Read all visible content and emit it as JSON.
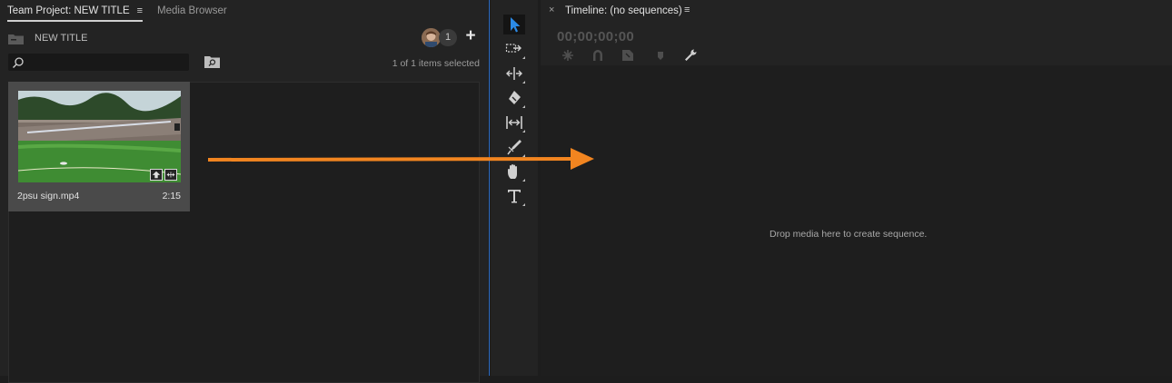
{
  "project_panel": {
    "tab_project": "Team Project: NEW TITLE",
    "tab_menu": "≡",
    "tab_media": "Media Browser",
    "project_name": "NEW TITLE",
    "collaborators_count": "1",
    "add_label": "+",
    "search": {
      "value": "",
      "placeholder": ""
    },
    "selected_status": "1 of 1 items selected",
    "clip": {
      "name": "2psu sign.mp4",
      "duration": "2:15"
    }
  },
  "tools": [
    {
      "name": "selection-tool",
      "icon": "selection-arrow-icon",
      "active": true
    },
    {
      "name": "track-select-tool",
      "icon": "track-select-icon",
      "active": false
    },
    {
      "name": "ripple-edit-tool",
      "icon": "ripple-edit-icon",
      "active": false
    },
    {
      "name": "razor-tool",
      "icon": "razor-icon",
      "active": false
    },
    {
      "name": "slip-tool",
      "icon": "slip-icon",
      "active": false
    },
    {
      "name": "pen-tool",
      "icon": "pen-icon",
      "active": false
    },
    {
      "name": "hand-tool",
      "icon": "hand-icon",
      "active": false
    },
    {
      "name": "type-tool",
      "icon": "type-icon",
      "active": false
    }
  ],
  "timeline_panel": {
    "close_label": "×",
    "title": "Timeline: (no sequences)",
    "tab_menu": "≡",
    "timecode": "00;00;00;00",
    "drop_message": "Drop media here to create sequence."
  },
  "colors": {
    "accent_blue": "#2b8ae6",
    "arrow_orange": "#f28520",
    "panel_bg": "#232323"
  }
}
